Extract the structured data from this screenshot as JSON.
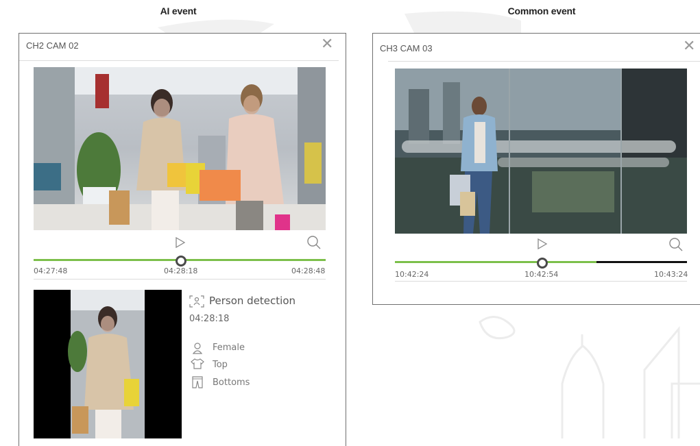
{
  "captions": {
    "left": "AI event",
    "right": "Common event"
  },
  "ai_panel": {
    "title": "CH2 CAM 02",
    "close_icon": "close-icon",
    "controls": {
      "play_icon": "play-icon",
      "zoom_icon": "search-icon"
    },
    "timeline": {
      "start": "04:27:48",
      "middle": "04:28:18",
      "end": "04:28:48",
      "position_fraction": 0.5,
      "progress_color": "#7cbf4a"
    },
    "event": {
      "icon": "person-detection-icon",
      "label": "Person detection",
      "time": "04:28:18",
      "attributes": [
        {
          "icon": "person-icon",
          "label": "Female"
        },
        {
          "icon": "shirt-icon",
          "label": "Top"
        },
        {
          "icon": "pants-icon",
          "label": "Bottoms"
        }
      ]
    }
  },
  "common_panel": {
    "title": "CH3 CAM 03",
    "close_icon": "close-icon",
    "controls": {
      "play_icon": "play-icon",
      "zoom_icon": "search-icon"
    },
    "timeline": {
      "start": "10:42:24",
      "middle": "10:42:54",
      "end": "10:43:24",
      "position_fraction": 0.5,
      "progress_fraction": 0.68,
      "progress_color": "#7cbf4a",
      "remainder_color": "#111111"
    }
  }
}
